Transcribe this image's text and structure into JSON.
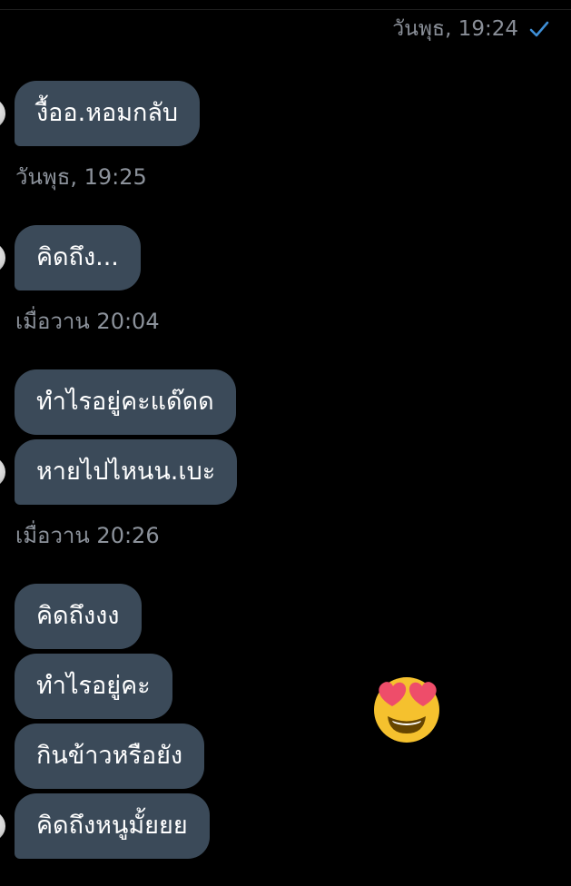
{
  "header": {
    "sent_timestamp": "วันพุธ, 19:24",
    "read_status": "check-icon"
  },
  "colors": {
    "background": "#000000",
    "bubble": "#3b4a59",
    "timestamp": "#8c929b",
    "check": "#3f8fd6"
  },
  "messages": [
    {
      "group": 1,
      "text": "งื้ออ.หอมกลับ"
    },
    {
      "group": 1,
      "timestamp": "วันพุธ, 19:25"
    },
    {
      "group": 2,
      "text": "คิดถึง..."
    },
    {
      "group": 2,
      "timestamp": "เมื่อวาน 20:04"
    },
    {
      "group": 3,
      "text": "ทำไรอยู่คะแด๊ดด"
    },
    {
      "group": 3,
      "text": "หายไปไหนน.เบะ"
    },
    {
      "group": 3,
      "timestamp": "เมื่อวาน 20:26"
    },
    {
      "group": 4,
      "text": "คิดถึงงง"
    },
    {
      "group": 4,
      "text": "ทำไรอยู่คะ"
    },
    {
      "group": 4,
      "text": "กินข้าวหรือยัง"
    },
    {
      "group": 4,
      "text": "คิดถึงหนูมั้ยยย"
    }
  ],
  "reaction": {
    "icon": "heart-eyes-emoji"
  }
}
